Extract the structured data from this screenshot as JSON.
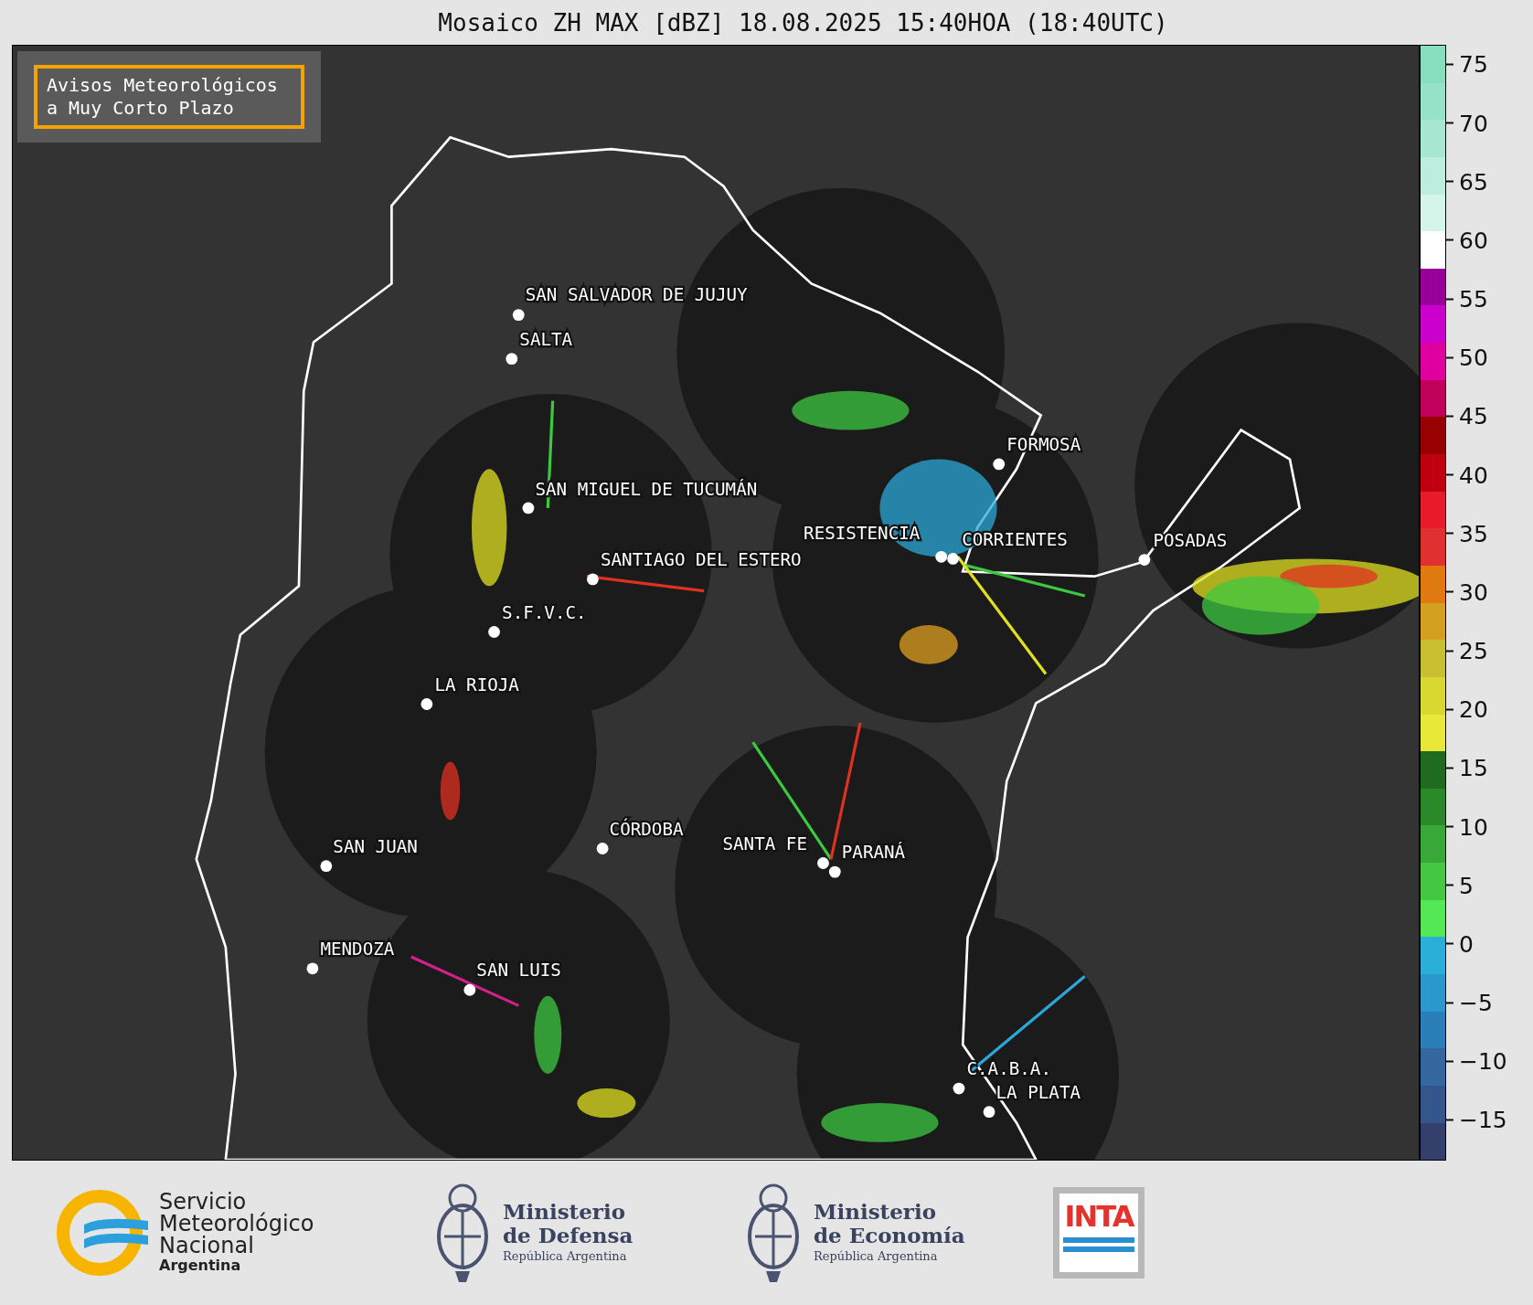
{
  "title": "Mosaico ZH MAX [dBZ] 18.08.2025 15:40HOA (18:40UTC)",
  "warning_box": {
    "lines": [
      "Avisos Meteorológicos",
      "a Muy Corto Plazo"
    ]
  },
  "cities": [
    {
      "name": "SAN SALVADOR DE JUJUY"
    },
    {
      "name": "SALTA"
    },
    {
      "name": "FORMOSA"
    },
    {
      "name": "SAN MIGUEL DE TUCUMÁN"
    },
    {
      "name": "RESISTENCIA"
    },
    {
      "name": "CORRIENTES"
    },
    {
      "name": "POSADAS"
    },
    {
      "name": "SANTIAGO DEL ESTERO"
    },
    {
      "name": "S.F.V.C."
    },
    {
      "name": "LA RIOJA"
    },
    {
      "name": "SAN JUAN"
    },
    {
      "name": "CÓRDOBA"
    },
    {
      "name": "SANTA FE"
    },
    {
      "name": "PARANÁ"
    },
    {
      "name": "MENDOZA"
    },
    {
      "name": "SAN LUIS"
    },
    {
      "name": "C.A.B.A."
    },
    {
      "name": "LA PLATA"
    }
  ],
  "colorbar": {
    "ticks": [
      "75",
      "70",
      "65",
      "60",
      "55",
      "50",
      "45",
      "40",
      "35",
      "30",
      "25",
      "20",
      "15",
      "10",
      "5",
      "0",
      "−5",
      "−10",
      "−15"
    ]
  },
  "logos": [
    {
      "kind": "smn",
      "lines": [
        "Servicio",
        "Meteorológico",
        "Nacional"
      ],
      "subtitle": "Argentina"
    },
    {
      "kind": "ministry",
      "lines": [
        "Ministerio",
        "de Defensa"
      ],
      "subtitle": "República Argentina"
    },
    {
      "kind": "ministry",
      "lines": [
        "Ministerio",
        "de Economía"
      ],
      "subtitle": "República Argentina"
    },
    {
      "kind": "inta",
      "text": "INTA"
    }
  ]
}
